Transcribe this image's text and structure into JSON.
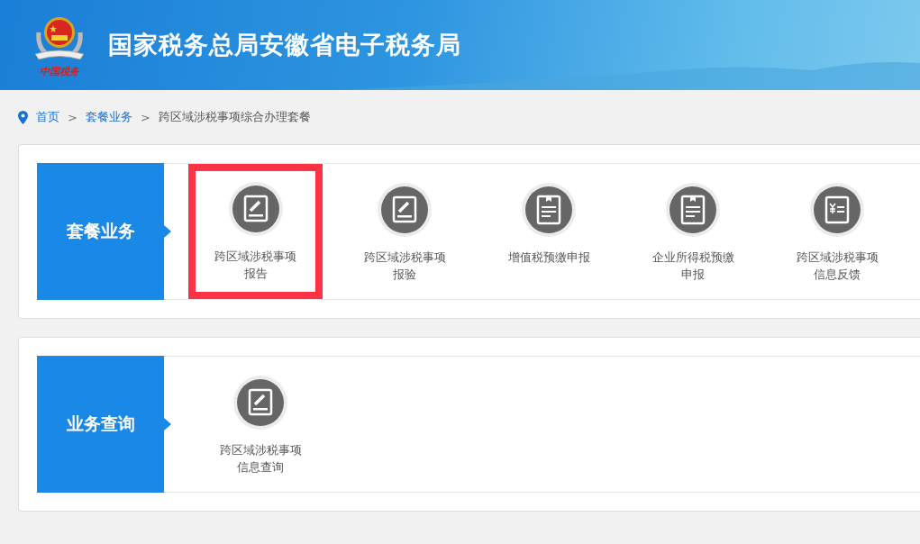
{
  "header": {
    "logo_text": "中国税务",
    "title": "国家税务总局安徽省电子税务局"
  },
  "breadcrumb": [
    {
      "label": "首页",
      "kind": "link"
    },
    {
      "label": "套餐业务",
      "kind": "link"
    },
    {
      "label": "跨区域涉税事项综合办理套餐",
      "kind": "current"
    }
  ],
  "breadcrumb_separator": ">",
  "sections": [
    {
      "title": "套餐业务",
      "items": [
        {
          "label": "跨区域涉税事项报告",
          "kind": "pen",
          "highlighted": true
        },
        {
          "label": "跨区域涉税事项报验",
          "kind": "pen",
          "highlighted": false
        },
        {
          "label": "增值税预缴申报",
          "kind": "doc",
          "highlighted": false
        },
        {
          "label": "企业所得税预缴申报",
          "kind": "doc",
          "highlighted": false
        },
        {
          "label": "跨区域涉税事项信息反馈",
          "kind": "yen",
          "highlighted": false
        }
      ]
    },
    {
      "title": "业务查询",
      "items": [
        {
          "label": "跨区域涉税事项信息查询",
          "kind": "pen",
          "highlighted": false
        }
      ]
    }
  ]
}
